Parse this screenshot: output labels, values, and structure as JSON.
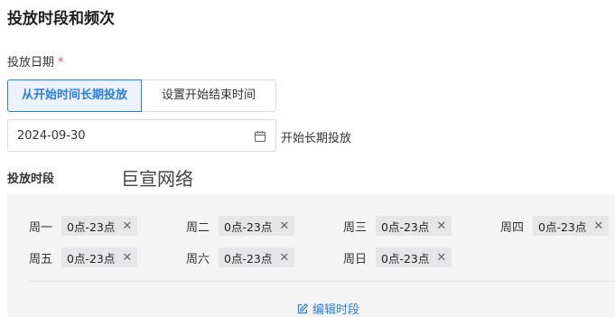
{
  "section_title": "投放时段和频次",
  "date_field": {
    "label": "投放日期",
    "required_mark": "*",
    "options": [
      {
        "label": "从开始时间长期投放",
        "active": true
      },
      {
        "label": "设置开始结束时间",
        "active": false
      }
    ],
    "value": "2024-09-30",
    "hint": "开始长期投放"
  },
  "slot_field": {
    "label": "投放时段",
    "watermark": "巨宣网络",
    "days": [
      {
        "name": "周一",
        "range": "0点-23点"
      },
      {
        "name": "周二",
        "range": "0点-23点"
      },
      {
        "name": "周三",
        "range": "0点-23点"
      },
      {
        "name": "周四",
        "range": "0点-23点"
      },
      {
        "name": "周五",
        "range": "0点-23点"
      },
      {
        "name": "周六",
        "range": "0点-23点"
      },
      {
        "name": "周日",
        "range": "0点-23点"
      }
    ],
    "tag_close_glyph": "✕",
    "edit_label": "编辑时段"
  },
  "colors": {
    "accent": "#2b7de9",
    "required": "#e34d59",
    "panel_bg": "#f4f4f5"
  },
  "icons": {
    "date": "calendar-icon",
    "edit": "edit-icon",
    "remove": "close-icon"
  }
}
